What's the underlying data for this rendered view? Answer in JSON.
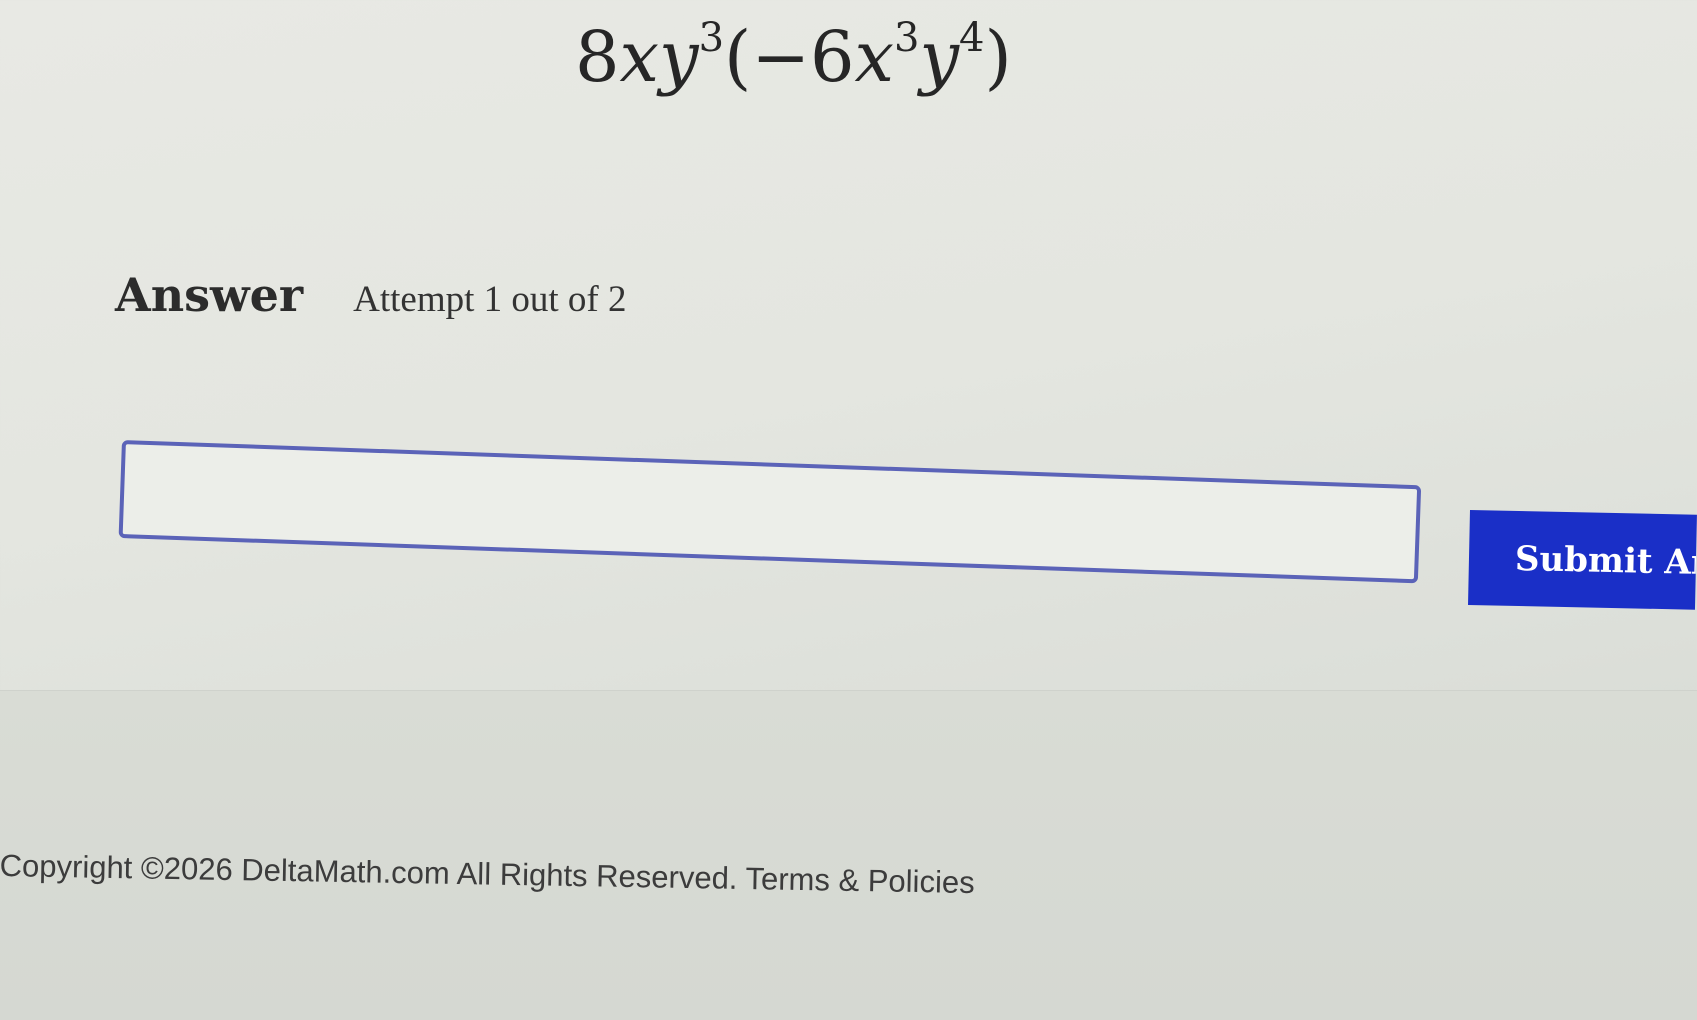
{
  "problem": {
    "coef1": "8",
    "var_x1": "x",
    "var_y1": "y",
    "exp_y1": "3",
    "open": "(−",
    "coef2": "6",
    "var_x2": "x",
    "exp_x2": "3",
    "var_y2": "y",
    "exp_y2": "4",
    "close": ")"
  },
  "answer": {
    "label": "Answer",
    "attempt": "Attempt 1 out of 2",
    "input_value": ""
  },
  "submit": {
    "label": "Submit Answer"
  },
  "footer": {
    "copyright": "Copyright ©2026 DeltaMath.com All Rights Reserved.",
    "terms_link": "Terms & Policies"
  },
  "colors": {
    "submit_bg": "#1a2fc7",
    "input_border": "#5b63b8"
  }
}
